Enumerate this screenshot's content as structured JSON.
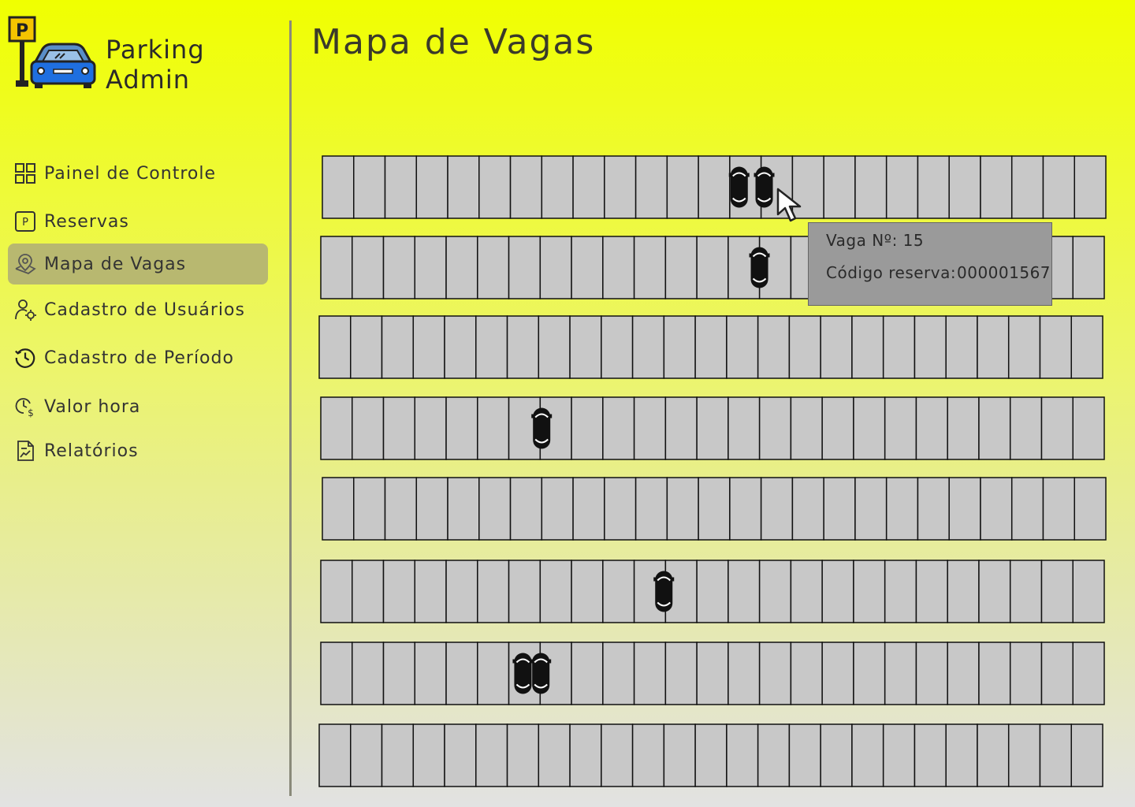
{
  "brand": {
    "line1": "Parking",
    "line2": "Admin",
    "sign_letter": "P"
  },
  "nav": [
    {
      "label": "Painel de Controle",
      "icon": "grid-icon",
      "active": false
    },
    {
      "label": "Reservas",
      "icon": "parking-square-icon",
      "active": false
    },
    {
      "label": "Mapa de Vagas",
      "icon": "map-pin-icon",
      "active": true
    },
    {
      "label": "Cadastro de Usuários",
      "icon": "user-gear-icon",
      "active": false
    },
    {
      "label": "Cadastro de Período",
      "icon": "clock-history-icon",
      "active": false
    },
    {
      "label": "Valor hora",
      "icon": "clock-dollar-icon",
      "active": false
    },
    {
      "label": "Relatórios",
      "icon": "report-chart-icon",
      "active": false
    }
  ],
  "page": {
    "title": "Mapa de Vagas"
  },
  "lot": {
    "rows": 8,
    "spots_per_row": 25,
    "occupied": [
      [
        0,
        13
      ],
      [
        0,
        14
      ],
      [
        1,
        14
      ],
      [
        3,
        7
      ],
      [
        5,
        11
      ],
      [
        6,
        6
      ],
      [
        6,
        7
      ]
    ]
  },
  "tooltip": {
    "vaga_label": "Vaga Nº: 15",
    "codigo_label": "Código reserva:",
    "codigo_value": "000001567"
  },
  "colors": {
    "spot_fill": "#c8c8c8",
    "active_nav": "#b8b870",
    "tooltip_bg": "#9a9a9a"
  }
}
